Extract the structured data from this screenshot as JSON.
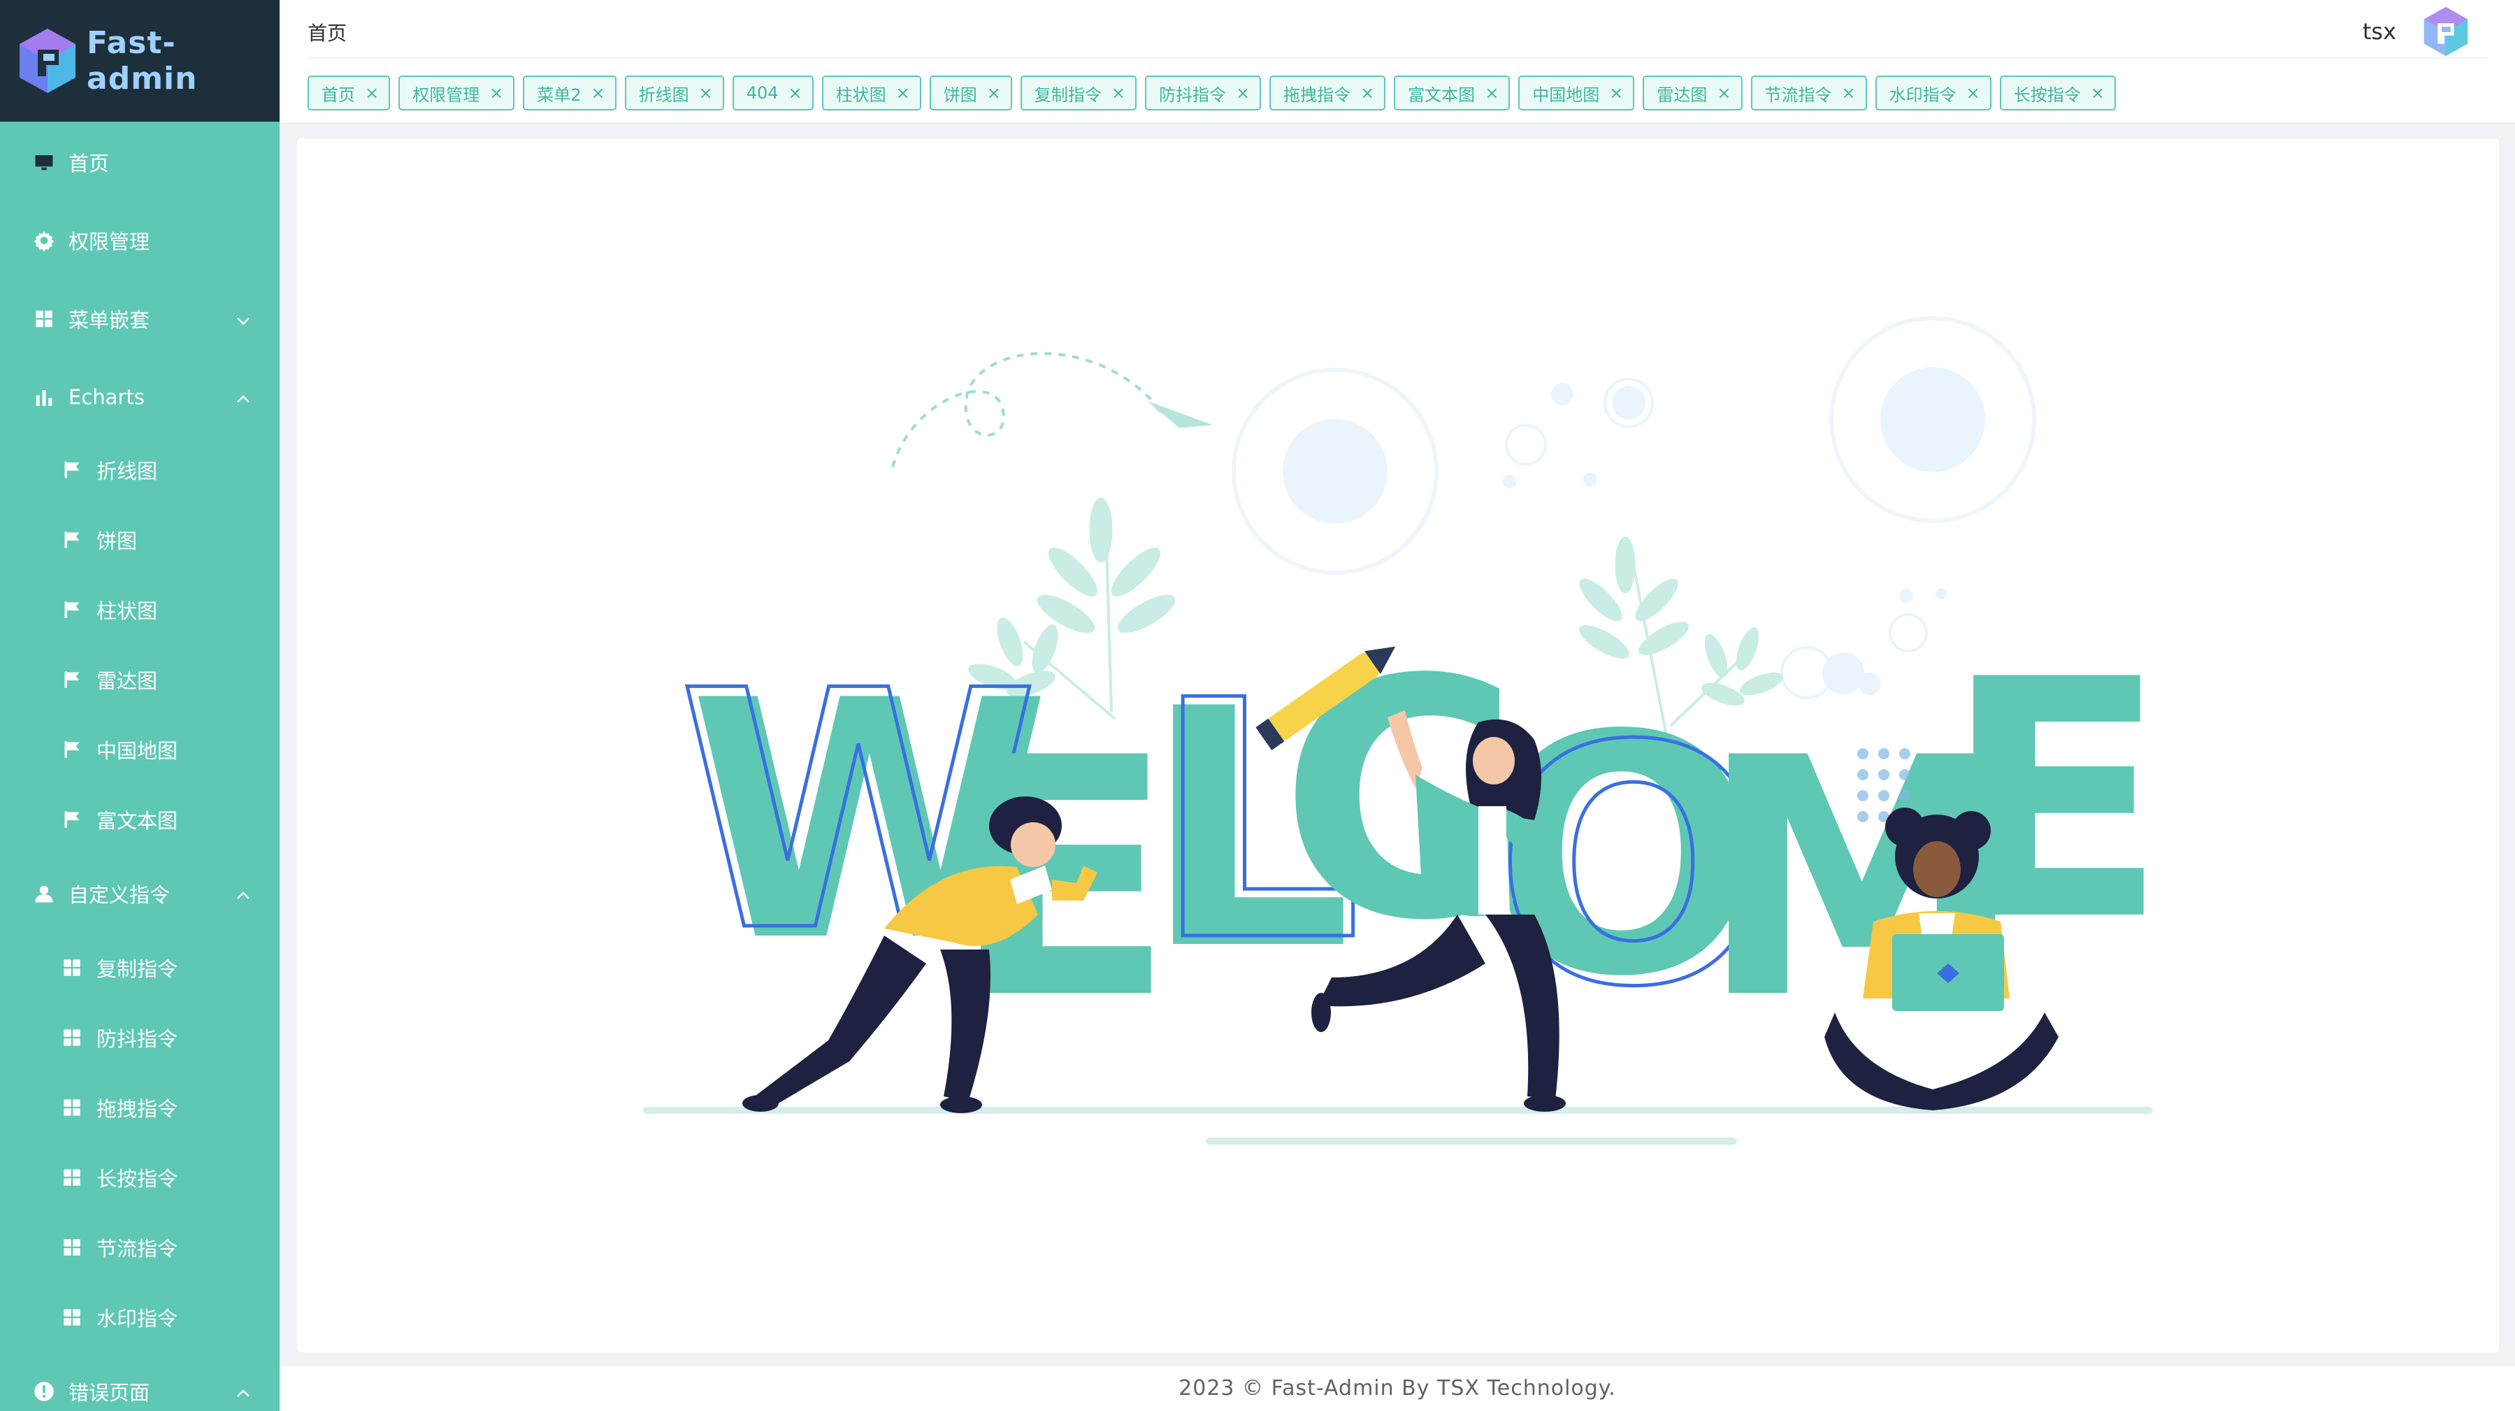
{
  "app": {
    "logo_text": "Fast-admin",
    "accent_color": "#5ec8b4",
    "logo_bar_color": "#1d2f3a"
  },
  "sidebar": {
    "items": [
      {
        "label": "首页",
        "icon": "monitor-icon"
      },
      {
        "label": "权限管理",
        "icon": "gear-icon"
      },
      {
        "label": "菜单嵌套",
        "icon": "grid-icon",
        "expanded": false
      },
      {
        "label": "Echarts",
        "icon": "bar-chart-icon",
        "expanded": true
      },
      {
        "label": "折线图",
        "icon": "flag-icon"
      },
      {
        "label": "饼图",
        "icon": "flag-icon"
      },
      {
        "label": "柱状图",
        "icon": "flag-icon"
      },
      {
        "label": "雷达图",
        "icon": "flag-icon"
      },
      {
        "label": "中国地图",
        "icon": "flag-icon"
      },
      {
        "label": "富文本图",
        "icon": "flag-icon"
      },
      {
        "label": "自定义指令",
        "icon": "user-icon",
        "expanded": true
      },
      {
        "label": "复制指令",
        "icon": "grid-icon"
      },
      {
        "label": "防抖指令",
        "icon": "grid-icon"
      },
      {
        "label": "拖拽指令",
        "icon": "grid-icon"
      },
      {
        "label": "长按指令",
        "icon": "grid-icon"
      },
      {
        "label": "节流指令",
        "icon": "grid-icon"
      },
      {
        "label": "水印指令",
        "icon": "grid-icon"
      },
      {
        "label": "错误页面",
        "icon": "alert-icon",
        "expanded": true
      }
    ]
  },
  "header": {
    "breadcrumb": "首页",
    "username": "tsx"
  },
  "tags": [
    "首页",
    "权限管理",
    "菜单2",
    "折线图",
    "404",
    "柱状图",
    "饼图",
    "复制指令",
    "防抖指令",
    "拖拽指令",
    "富文本图",
    "中国地图",
    "雷达图",
    "节流指令",
    "水印指令",
    "长按指令"
  ],
  "tag_close_glyph": "×",
  "main": {
    "illustration": "welcome-illustration",
    "welcome_text": "WELCOME"
  },
  "footer": {
    "text": "2023 © Fast-Admin By TSX Technology."
  }
}
